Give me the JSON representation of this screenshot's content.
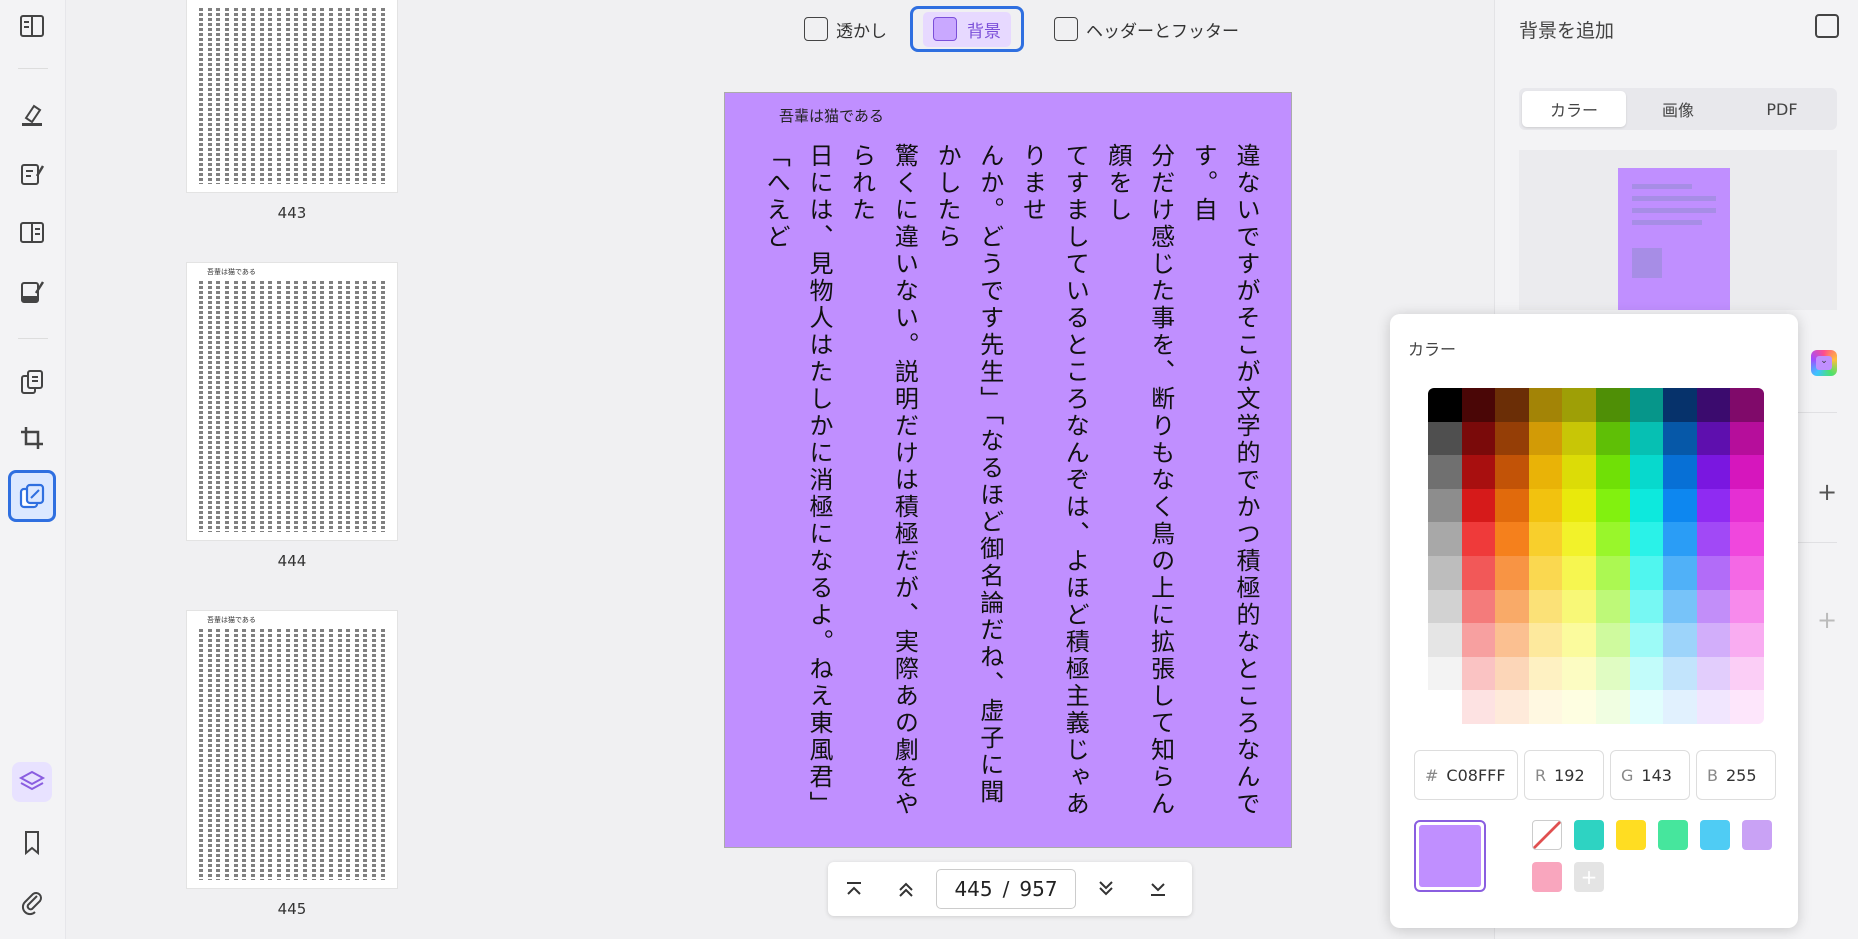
{
  "toolbar": {
    "watermark_label": "透かし",
    "background_label": "背景",
    "header_footer_label": "ヘッダーとフッター"
  },
  "thumbnails": [
    {
      "num": "443"
    },
    {
      "num": "444",
      "title": "吾輩は猫である"
    },
    {
      "num": "445",
      "title": "吾輩は猫である"
    }
  ],
  "page": {
    "title": "吾輩は猫である",
    "background": "#C08FFF",
    "text": "違ないですがそこが文学的でかつ積極的なところなんです。自\n分だけ感じた事を、断りもなく鳥の上に拡張して知らん顔をし\nてすましているところなんぞは、よほど積極主義じゃありませ\nんか。どうです先生」「なるほど御名論だね、虚子に聞かしたら\n驚くに違いない。説明だけは積極だが、実際あの劇をやられた\n日には、見物人はたしかに消極になるよ。ねえ東風君」「へえど\nうも消極過ぎるように思います」と真面目な顔をして答えた。\n　主人は少々談話の局面を展開して見たくなったと見えて、「ど\nうです、東風さん、近頃は傑作もありませんか」と聞くと東風\n君は「いえ、別段これと云って御目にかけるほどのものも出来\nませんが、近日詩集を出して見ようと思いまして——稿本を幸\nい持って参りましたから御批評を願いましょう」と懐から紫の\n袱紗包を出して、その中から五六十枚ほどの原稿紙の帳面を取"
  },
  "pager": {
    "current": "445",
    "separator": "/",
    "total": "957"
  },
  "right_panel": {
    "title": "背景を追加",
    "tabs": [
      "カラー",
      "画像",
      "PDF"
    ],
    "active_tab": 0
  },
  "color_popup": {
    "title": "カラー",
    "hex_label": "#",
    "hex_value": "C08FFF",
    "r_label": "R",
    "r_value": "192",
    "g_label": "G",
    "g_value": "143",
    "b_label": "B",
    "b_value": "255",
    "current_color": "#C08FFF",
    "presets": [
      "none",
      "#2ED3C2",
      "#FFDD22",
      "#46E69D",
      "#4FCCF4",
      "#C9A2F5",
      "#F9A6BE"
    ],
    "grid_rows": [
      [
        "#000000",
        "#4a0606",
        "#6b2e06",
        "#a38406",
        "#9e9f06",
        "#4f8f06",
        "#06968a",
        "#06326b",
        "#3b0b6e",
        "#800a6a"
      ],
      [
        "#4f4f4f",
        "#7a0a0a",
        "#953e06",
        "#d29b06",
        "#c8c606",
        "#5fbf06",
        "#06c0b3",
        "#0658a8",
        "#5e0fae",
        "#b60e9b"
      ],
      [
        "#707070",
        "#a80f0f",
        "#c25307",
        "#e9b307",
        "#dcdc07",
        "#70e006",
        "#07d9cd",
        "#0770d6",
        "#7a17e0",
        "#d616bd"
      ],
      [
        "#8d8d8d",
        "#d61a1a",
        "#e16a0c",
        "#f2c20f",
        "#e9e90c",
        "#82f10f",
        "#0de9dd",
        "#0d87f0",
        "#8f2bf2",
        "#e52fd3"
      ],
      [
        "#a8a8a8",
        "#ef3a3a",
        "#f5801c",
        "#f8cf2c",
        "#f2f22a",
        "#99f62b",
        "#2af2e8",
        "#2a9df6",
        "#a149f6",
        "#f047dd"
      ],
      [
        "#bdbdbd",
        "#f25858",
        "#f89444",
        "#fad850",
        "#f6f650",
        "#acf852",
        "#50f6ef",
        "#50b1f8",
        "#b26cf8",
        "#f468e5"
      ],
      [
        "#d2d2d2",
        "#f47b7b",
        "#f9aa68",
        "#fbe177",
        "#f8f877",
        "#bef978",
        "#77f8f3",
        "#77c3f9",
        "#c28ef9",
        "#f78aec"
      ],
      [
        "#e5e5e5",
        "#f7a0a0",
        "#fbc091",
        "#fde99d",
        "#fbfb9d",
        "#cffa9e",
        "#9dfbf7",
        "#9dd4fa",
        "#d2aefa",
        "#f9acf1"
      ],
      [
        "#f3f3f3",
        "#fac3c3",
        "#fcd6b8",
        "#fef1c2",
        "#fcfcc2",
        "#e0fcc2",
        "#c2fcfa",
        "#c2e4fc",
        "#e2cdfc",
        "#fbcef6"
      ],
      [
        "#ffffff",
        "#fde2e2",
        "#feeada",
        "#fff8e1",
        "#fefee1",
        "#f0fee1",
        "#e1fefd",
        "#e1f1fe",
        "#f1e6fe",
        "#fde6fb"
      ]
    ]
  }
}
